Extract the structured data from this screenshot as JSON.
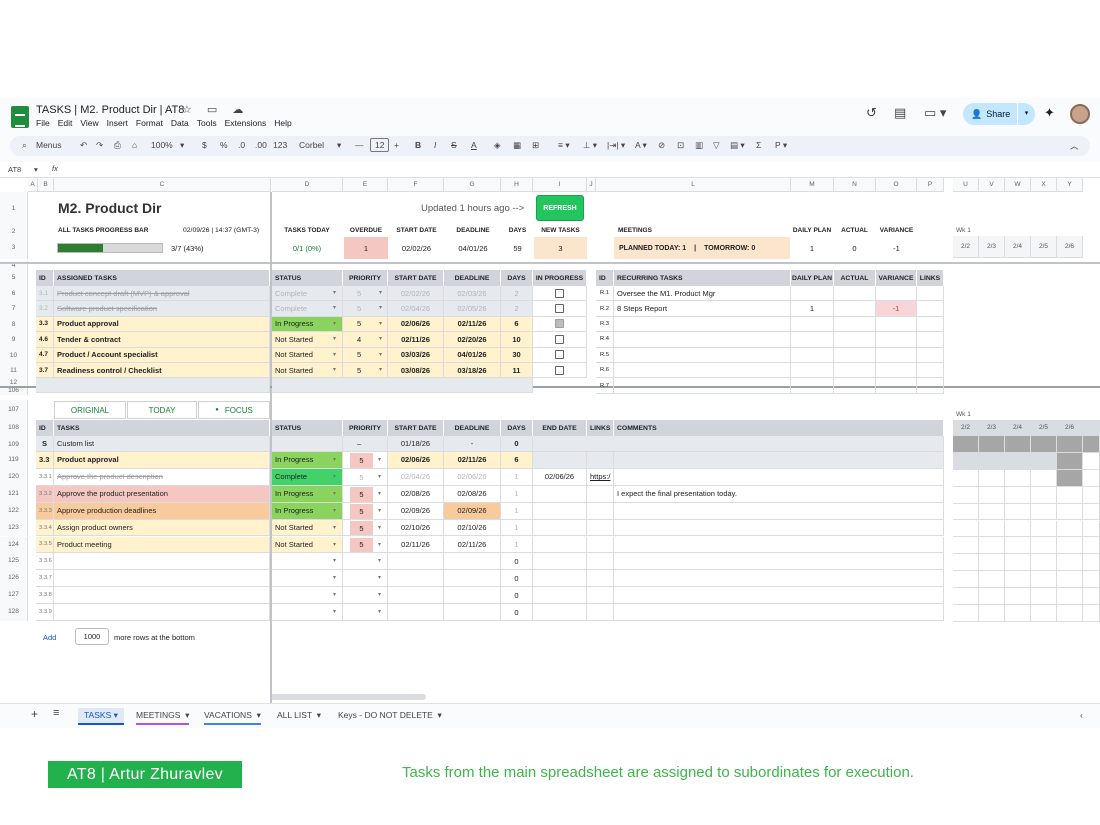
{
  "app": {
    "doc_title": "TASKS | M2. Product Dir | AT8",
    "menu": [
      "File",
      "Edit",
      "View",
      "Insert",
      "Format",
      "Data",
      "Tools",
      "Extensions",
      "Help"
    ],
    "share_label": "Share",
    "toolbar": {
      "menus": "Menus",
      "zoom": "100%",
      "currency": "$",
      "percent": "%",
      "dec_dec": ".0",
      "dec_inc": ".00",
      "num_fmt": "123",
      "font": "Corbel",
      "font_size": "12",
      "minus": "—",
      "plus": "+",
      "bold": "B",
      "italic": "I"
    },
    "cell_ref": "AT8",
    "fx": "fx"
  },
  "columns": [
    "A",
    "B",
    "C",
    "D",
    "E",
    "F",
    "G",
    "H",
    "I",
    "J",
    "L",
    "M",
    "N",
    "O",
    "P",
    "U",
    "V",
    "W",
    "X",
    "Y"
  ],
  "header": {
    "title": "M2. Product Dir",
    "updated": "Updated 1 hours ago -->",
    "refresh": "REFRESH",
    "progress_label": "ALL TASKS PROGRESS BAR",
    "timestamp": "02/09/26 | 14:37 (GMT-3)",
    "progress_text": "3/7 (43%)",
    "progress_fraction": 0.43,
    "tasks_today_label": "TASKS TODAY",
    "tasks_today": "0/1 (0%)",
    "overdue_label": "OVERDUE",
    "overdue": "1",
    "start_label": "START DATE",
    "start": "02/02/26",
    "deadline_label": "DEADLINE",
    "deadline": "04/01/26",
    "days_label": "DAYS",
    "days": "59",
    "new_tasks_label": "NEW TASKS",
    "new_tasks": "3",
    "meetings_label": "MEETINGS",
    "planned_today": "PLANNED TODAY: 1",
    "sep": "|",
    "tomorrow": "TOMORROW: 0",
    "daily_plan_label": "DAILY PLAN",
    "daily_plan": "1",
    "actual_label": "ACTUAL",
    "actual": "0",
    "variance_label": "VARIANCE",
    "variance": "-1",
    "week_label": "Wk 1",
    "week_days": [
      "2/2",
      "2/3",
      "2/4",
      "2/5",
      "2/6"
    ]
  },
  "assigned": {
    "headers": [
      "ID",
      "ASSIGNED TASKS",
      "STATUS",
      "PRIORITY",
      "START DATE",
      "DEADLINE",
      "DAYS",
      "IN PROGRESS"
    ],
    "rows": [
      {
        "row": "6",
        "id": "3.1",
        "task": "Product concept draft (MVP) & approval",
        "status": "Complete",
        "priority": "5",
        "start": "02/02/26",
        "deadline": "02/03/26",
        "days": "2",
        "checked": false
      },
      {
        "row": "7",
        "id": "3.2",
        "task": "Software product specification",
        "status": "Complete",
        "priority": "5",
        "start": "02/04/26",
        "deadline": "02/05/26",
        "days": "2",
        "checked": false
      },
      {
        "row": "8",
        "id": "3.3",
        "task": "Product approval",
        "status": "In Progress",
        "priority": "5",
        "start": "02/06/26",
        "deadline": "02/11/26",
        "days": "6",
        "checked": true
      },
      {
        "row": "9",
        "id": "4.6",
        "task": "Tender & contract",
        "status": "Not Started",
        "priority": "4",
        "start": "02/11/26",
        "deadline": "02/20/26",
        "days": "10",
        "checked": false
      },
      {
        "row": "10",
        "id": "4.7",
        "task": "Product / Account specialist",
        "status": "Not Started",
        "priority": "5",
        "start": "03/03/26",
        "deadline": "04/01/26",
        "days": "30",
        "checked": false
      },
      {
        "row": "11",
        "id": "3.7",
        "task": "Readiness control / Checklist",
        "status": "Not Started",
        "priority": "5",
        "start": "03/08/26",
        "deadline": "03/18/26",
        "days": "11",
        "checked": false
      }
    ]
  },
  "recurring": {
    "headers": [
      "ID",
      "RECURRING TASKS",
      "DAILY PLAN",
      "ACTUAL",
      "VARIANCE",
      "LINKS"
    ],
    "rows": [
      {
        "id": "R.1",
        "task": "Oversee the M1. Product Mgr",
        "plan": "",
        "variance": ""
      },
      {
        "id": "R.2",
        "task": "8 Steps Report",
        "plan": "1",
        "variance": "-1"
      },
      {
        "id": "R.3",
        "task": "",
        "plan": "",
        "variance": ""
      },
      {
        "id": "R.4",
        "task": "",
        "plan": "",
        "variance": ""
      },
      {
        "id": "R.5",
        "task": "",
        "plan": "",
        "variance": ""
      },
      {
        "id": "R.6",
        "task": "",
        "plan": "",
        "variance": ""
      },
      {
        "id": "R.7",
        "task": "",
        "plan": "",
        "variance": ""
      }
    ]
  },
  "view_tabs": [
    "ORIGINAL",
    "TODAY",
    "FOCUS"
  ],
  "focus_dot": "●",
  "detail": {
    "headers": [
      "ID",
      "TASKS",
      "STATUS",
      "PRIORITY",
      "START DATE",
      "DEADLINE",
      "DAYS",
      "END DATE",
      "LINKS",
      "COMMENTS"
    ],
    "custom": {
      "row": "109",
      "id": "S",
      "task": "Custom list",
      "priority": "–",
      "start": "01/18/26",
      "deadline": "-",
      "days": "0"
    },
    "rows": [
      {
        "row": "119",
        "id": "3.3",
        "task": "Product approval",
        "status": "In Progress",
        "priority": "5",
        "start": "02/06/26",
        "deadline": "02/11/26",
        "days": "6",
        "end": "",
        "links": "",
        "comment": "",
        "kind": "parent"
      },
      {
        "row": "120",
        "id": "3.3.1",
        "task": "Approve the product description",
        "status": "Complete",
        "priority": "5",
        "start": "02/04/26",
        "deadline": "02/06/26",
        "days": "1",
        "end": "02/06/26",
        "links": "https:/",
        "comment": "",
        "kind": "done"
      },
      {
        "row": "121",
        "id": "3.3.2",
        "task": "Approve the product presentation",
        "status": "In Progress",
        "priority": "5",
        "start": "02/08/26",
        "deadline": "02/08/26",
        "days": "1",
        "end": "",
        "links": "",
        "comment": "I expect the final presentation today.",
        "kind": "pink"
      },
      {
        "row": "122",
        "id": "3.3.3",
        "task": "Approve production deadlines",
        "status": "In Progress",
        "priority": "5",
        "start": "02/09/26",
        "deadline": "02/09/26",
        "days": "1",
        "end": "",
        "links": "",
        "comment": "",
        "kind": "orange"
      },
      {
        "row": "123",
        "id": "3.3.4",
        "task": "Assign product owners",
        "status": "Not Started",
        "priority": "5",
        "start": "02/10/26",
        "deadline": "02/10/26",
        "days": "1",
        "end": "",
        "links": "",
        "comment": "",
        "kind": "yellow"
      },
      {
        "row": "124",
        "id": "3.3.5",
        "task": "Product meeting",
        "status": "Not Started",
        "priority": "5",
        "start": "02/11/26",
        "deadline": "02/11/26",
        "days": "1",
        "end": "",
        "links": "",
        "comment": "",
        "kind": "yellow"
      },
      {
        "row": "125",
        "id": "3.3.6",
        "task": "",
        "status": "",
        "priority": "",
        "start": "",
        "deadline": "",
        "days": "0",
        "end": "",
        "links": "",
        "comment": "",
        "kind": "empty"
      },
      {
        "row": "126",
        "id": "3.3.7",
        "task": "",
        "status": "",
        "priority": "",
        "start": "",
        "deadline": "",
        "days": "0",
        "end": "",
        "links": "",
        "comment": "",
        "kind": "empty"
      },
      {
        "row": "127",
        "id": "3.3.8",
        "task": "",
        "status": "",
        "priority": "",
        "start": "",
        "deadline": "",
        "days": "0",
        "end": "",
        "links": "",
        "comment": "",
        "kind": "empty"
      },
      {
        "row": "128",
        "id": "3.3.9",
        "task": "",
        "status": "",
        "priority": "",
        "start": "",
        "deadline": "",
        "days": "0",
        "end": "",
        "links": "",
        "comment": "",
        "kind": "empty"
      }
    ]
  },
  "row_numbers": {
    "r1": "1",
    "r2": "2",
    "r3": "3",
    "r4": "4",
    "r5": "5",
    "r12": "12",
    "r106": "106",
    "r107": "107",
    "r108": "108"
  },
  "add_rows": {
    "label": "Add",
    "count": "1000",
    "suffix": "more rows at the bottom"
  },
  "sheet_tabs": [
    "TASKS",
    "MEETINGS",
    "VACATIONS",
    "ALL LIST",
    "Keys - DO NOT DELETE"
  ],
  "footer": {
    "brand": "AT8 | Artur Zhuravlev",
    "caption": "Tasks from the main spreadsheet are assigned to subordinates for execution."
  }
}
